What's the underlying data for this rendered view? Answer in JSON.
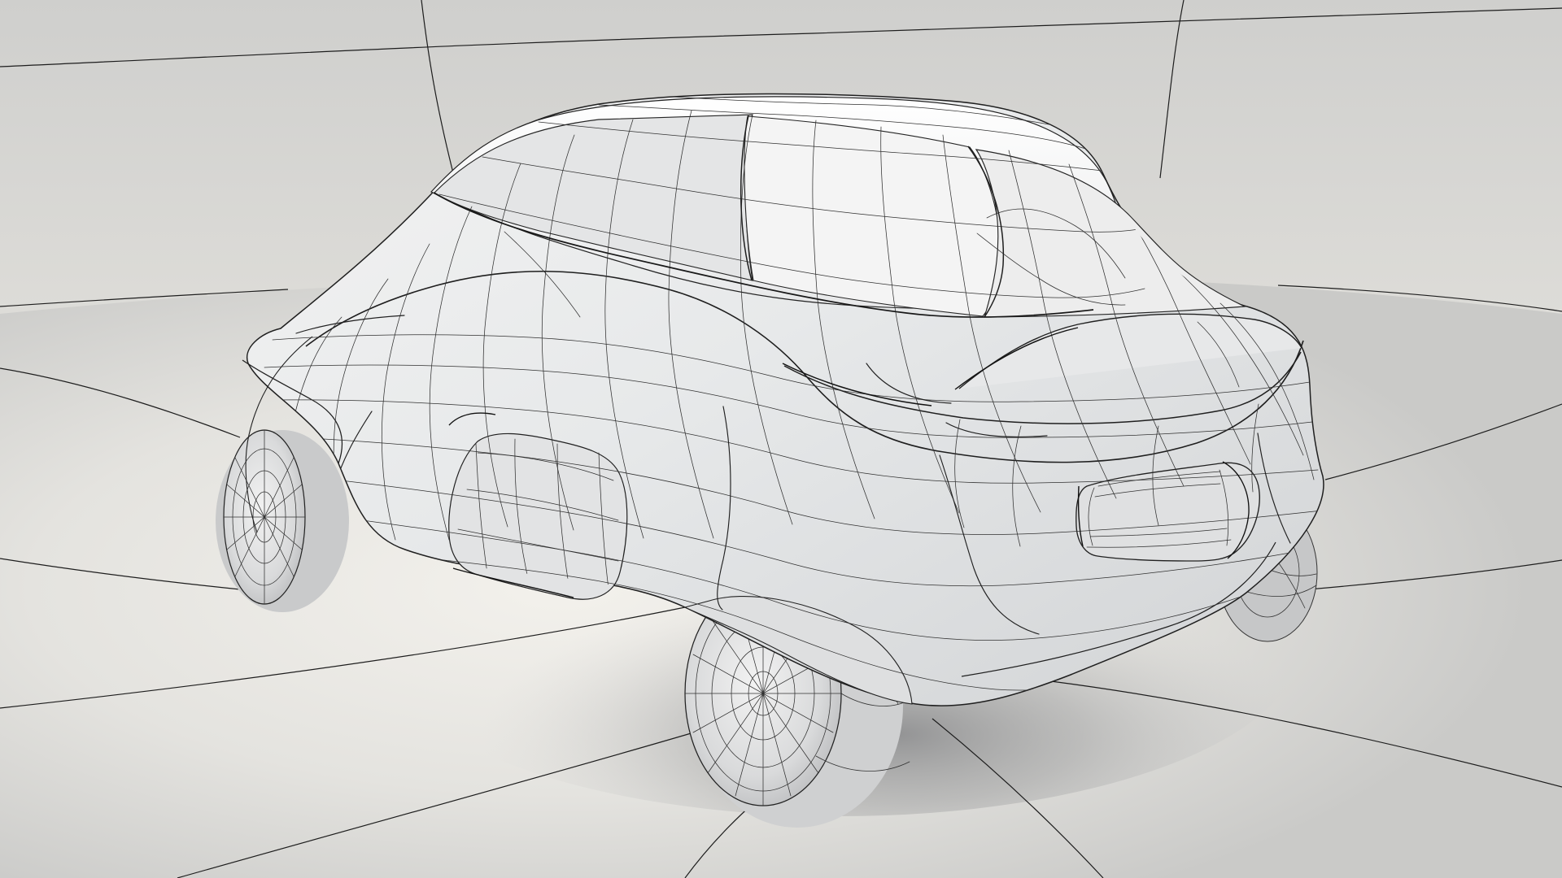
{
  "scene": {
    "subject": "",
    "colors": {
      "background_top": "#d3d3d2",
      "background_mid": "#e6e5e1",
      "floor": "#e7e6e2",
      "body": "#eeefef",
      "shadow": "#8c8d8f",
      "wire": "#202020"
    }
  }
}
